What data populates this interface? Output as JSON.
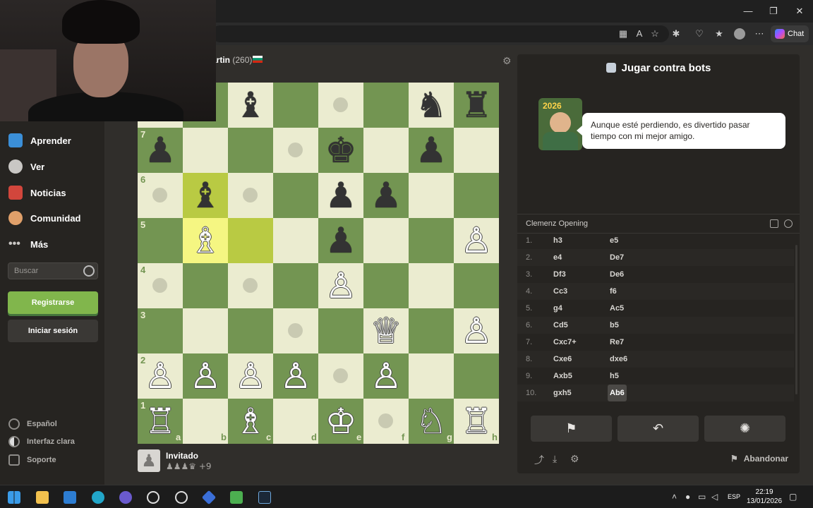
{
  "browser": {
    "chat_label": "Chat",
    "window_controls": [
      "minimize-icon",
      "restore-icon",
      "close-icon"
    ]
  },
  "sidebar": {
    "items": [
      {
        "label": "Aprender",
        "icon": "learn-icon"
      },
      {
        "label": "Ver",
        "icon": "binoculars-icon"
      },
      {
        "label": "Noticias",
        "icon": "news-icon"
      },
      {
        "label": "Comunidad",
        "icon": "community-icon"
      },
      {
        "label": "Más",
        "icon": "more-dots-icon"
      }
    ],
    "search_placeholder": "Buscar",
    "register_label": "Registrarse",
    "login_label": "Iniciar sesión",
    "footer": [
      {
        "label": "Español",
        "icon": "globe-icon"
      },
      {
        "label": "Interfaz clara",
        "icon": "contrast-icon"
      },
      {
        "label": "Soporte",
        "icon": "help-icon"
      }
    ]
  },
  "game": {
    "opponent_name": "artin",
    "opponent_rating": "(260)",
    "player_name": "Invitado",
    "player_captured": "♟♟♟♛",
    "player_advantage": "+9",
    "colors": {
      "light": "#ebecd0",
      "dark": "#739552",
      "highlight_light": "#f5f682",
      "highlight_dark": "#b9ca43"
    },
    "files": [
      "a",
      "b",
      "c",
      "d",
      "e",
      "f",
      "g",
      "h"
    ],
    "ranks": [
      "1",
      "2",
      "3",
      "4",
      "5",
      "6",
      "7"
    ],
    "pieces": [
      {
        "sq": "c8",
        "p": "♝",
        "c": "b"
      },
      {
        "sq": "g8",
        "p": "♞",
        "c": "b"
      },
      {
        "sq": "h8",
        "p": "♜",
        "c": "b"
      },
      {
        "sq": "a7",
        "p": "♟",
        "c": "b"
      },
      {
        "sq": "e7",
        "p": "♚",
        "c": "b"
      },
      {
        "sq": "g7",
        "p": "♟",
        "c": "b"
      },
      {
        "sq": "b6",
        "p": "♝",
        "c": "b"
      },
      {
        "sq": "e6",
        "p": "♟",
        "c": "b"
      },
      {
        "sq": "f6",
        "p": "♟",
        "c": "b"
      },
      {
        "sq": "b5",
        "p": "♗",
        "c": "w"
      },
      {
        "sq": "e5",
        "p": "♟",
        "c": "b"
      },
      {
        "sq": "h5",
        "p": "♙",
        "c": "w"
      },
      {
        "sq": "e4",
        "p": "♙",
        "c": "w"
      },
      {
        "sq": "f3",
        "p": "♕",
        "c": "w"
      },
      {
        "sq": "h3",
        "p": "♙",
        "c": "w"
      },
      {
        "sq": "a2",
        "p": "♙",
        "c": "w"
      },
      {
        "sq": "b2",
        "p": "♙",
        "c": "w"
      },
      {
        "sq": "c2",
        "p": "♙",
        "c": "w"
      },
      {
        "sq": "d2",
        "p": "♙",
        "c": "w"
      },
      {
        "sq": "f2",
        "p": "♙",
        "c": "w"
      },
      {
        "sq": "a1",
        "p": "♖",
        "c": "w"
      },
      {
        "sq": "c1",
        "p": "♗",
        "c": "w"
      },
      {
        "sq": "e1",
        "p": "♔",
        "c": "w"
      },
      {
        "sq": "g1",
        "p": "♘",
        "c": "w"
      },
      {
        "sq": "h1",
        "p": "♖",
        "c": "w"
      }
    ],
    "highlighted": [
      "b6",
      "b5",
      "c5"
    ],
    "dots": [
      "e8",
      "d7",
      "a6",
      "c6",
      "a4",
      "c4",
      "d3",
      "e2",
      "f1"
    ]
  },
  "panel": {
    "title": "Jugar contra bots",
    "bot_badge": "2026",
    "bot_message": "Aunque esté perdiendo, es divertido pasar tiempo con mi mejor amigo.",
    "opening": "Clemenz Opening",
    "moves": [
      {
        "n": "1.",
        "w": "h3",
        "b": "e5"
      },
      {
        "n": "2.",
        "w": "e4",
        "b": "De7"
      },
      {
        "n": "3.",
        "w": "Df3",
        "b": "De6"
      },
      {
        "n": "4.",
        "w": "Cc3",
        "b": "f6"
      },
      {
        "n": "5.",
        "w": "g4",
        "b": "Ac5"
      },
      {
        "n": "6.",
        "w": "Cd5",
        "b": "b5"
      },
      {
        "n": "7.",
        "w": "Cxc7+",
        "b": "Re7"
      },
      {
        "n": "8.",
        "w": "Cxe6",
        "b": "dxe6"
      },
      {
        "n": "9.",
        "w": "Axb5",
        "b": "h5"
      },
      {
        "n": "10.",
        "w": "gxh5",
        "b": "Ab6"
      }
    ],
    "abandon_label": "Abandonar"
  },
  "taskbar": {
    "lang": "ESP",
    "time": "22:19",
    "date": "13/01/2026"
  }
}
